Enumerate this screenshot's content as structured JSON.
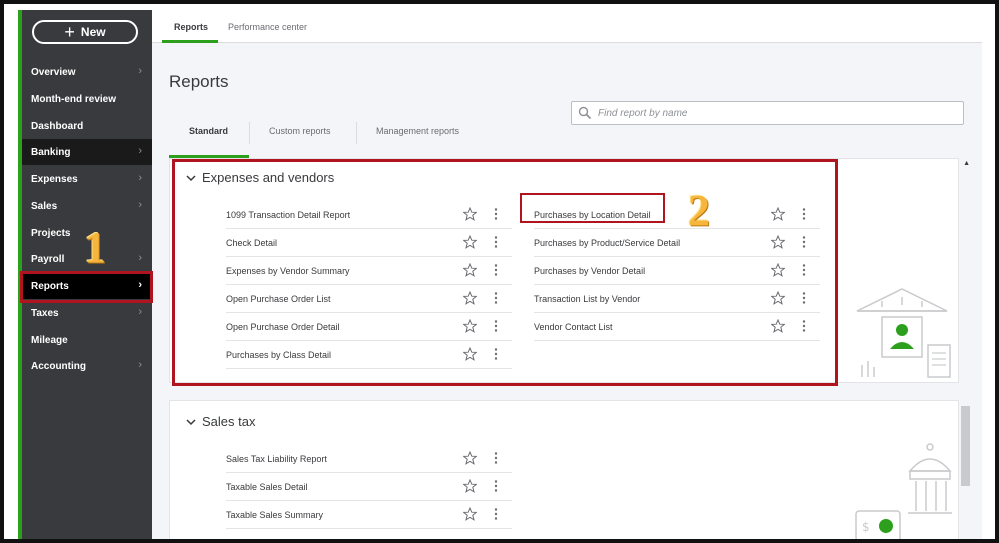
{
  "sidebar": {
    "new_label": "New",
    "items": [
      {
        "label": "Overview"
      },
      {
        "label": "Month-end review"
      },
      {
        "label": "Dashboard"
      },
      {
        "label": "Banking"
      },
      {
        "label": "Expenses"
      },
      {
        "label": "Sales"
      },
      {
        "label": "Projects"
      },
      {
        "label": "Payroll"
      },
      {
        "label": "Reports"
      },
      {
        "label": "Taxes"
      },
      {
        "label": "Mileage"
      },
      {
        "label": "Accounting"
      }
    ]
  },
  "top_tabs": [
    "Reports",
    "Performance center"
  ],
  "page_title": "Reports",
  "search": {
    "placeholder": "Find report by name"
  },
  "sub_tabs": [
    "Standard",
    "Custom reports",
    "Management reports"
  ],
  "sections": {
    "expenses": {
      "title": "Expenses and vendors",
      "col1": [
        "1099 Transaction Detail Report",
        "Check Detail",
        "Expenses by Vendor Summary",
        "Open Purchase Order List",
        "Open Purchase Order Detail",
        "Purchases by Class Detail"
      ],
      "col2": [
        "Purchases by Location Detail",
        "Purchases by Product/Service Detail",
        "Purchases by Vendor Detail",
        "Transaction List by Vendor",
        "Vendor Contact List"
      ]
    },
    "sales_tax": {
      "title": "Sales tax",
      "col1": [
        "Sales Tax Liability Report",
        "Taxable Sales Detail",
        "Taxable Sales Summary"
      ]
    }
  },
  "annotations": {
    "step1": "1",
    "step2": "2"
  },
  "colors": {
    "accent_green": "#2ca01c",
    "sidebar_bg": "#393a3d",
    "highlight_red": "#b0141e",
    "badge_orange": "#f6b53d"
  }
}
